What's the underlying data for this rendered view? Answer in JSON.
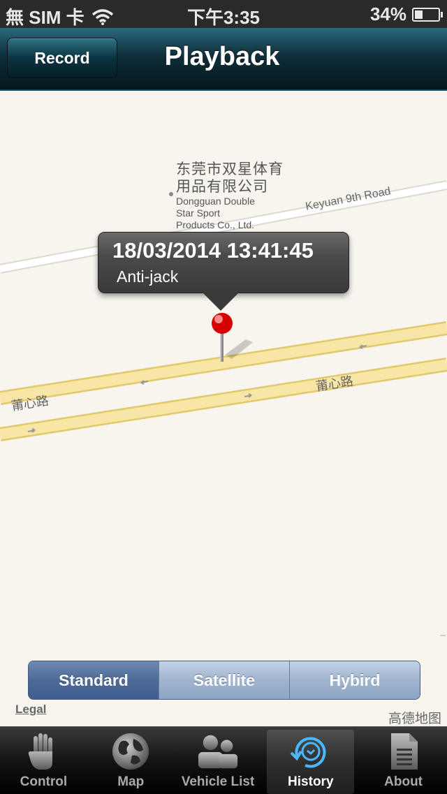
{
  "status_bar": {
    "carrier": "無 SIM 卡",
    "time": "下午3:35",
    "battery": "34%",
    "battery_level": 0.34
  },
  "nav": {
    "record_label": "Record",
    "title": "Playback"
  },
  "map": {
    "poi_cn_line1": "东莞市双星体育",
    "poi_cn_line2": "用品有限公司",
    "poi_en_line1": "Dongguan Double",
    "poi_en_line2": "Star Sport",
    "poi_en_line3": "Products Co., Ltd.",
    "road_keyuan": "Keyuan 9th Road",
    "road_puxin_1": "莆心路",
    "road_puxin_2": "莆心路",
    "callout_title": "18/03/2014 13:41:45",
    "callout_subtitle": "Anti-jack",
    "legal": "Legal",
    "provider": "高德地图"
  },
  "map_types": {
    "options": [
      "Standard",
      "Satellite",
      "Hybird"
    ],
    "selected": "Standard"
  },
  "tabs": [
    {
      "label": "Control",
      "icon": "hand-icon"
    },
    {
      "label": "Map",
      "icon": "globe-icon"
    },
    {
      "label": "Vehicle List",
      "icon": "people-icon"
    },
    {
      "label": "History",
      "icon": "clock-history-icon",
      "active": true
    },
    {
      "label": "About",
      "icon": "document-icon"
    }
  ],
  "colors": {
    "nav_bar": "#0e2e3a",
    "road": "#f5e3a0",
    "road_edge": "#e3c86a",
    "pin": "#d60000",
    "segment_active": "#4d6b98",
    "history_accent": "#4ab8ff"
  }
}
